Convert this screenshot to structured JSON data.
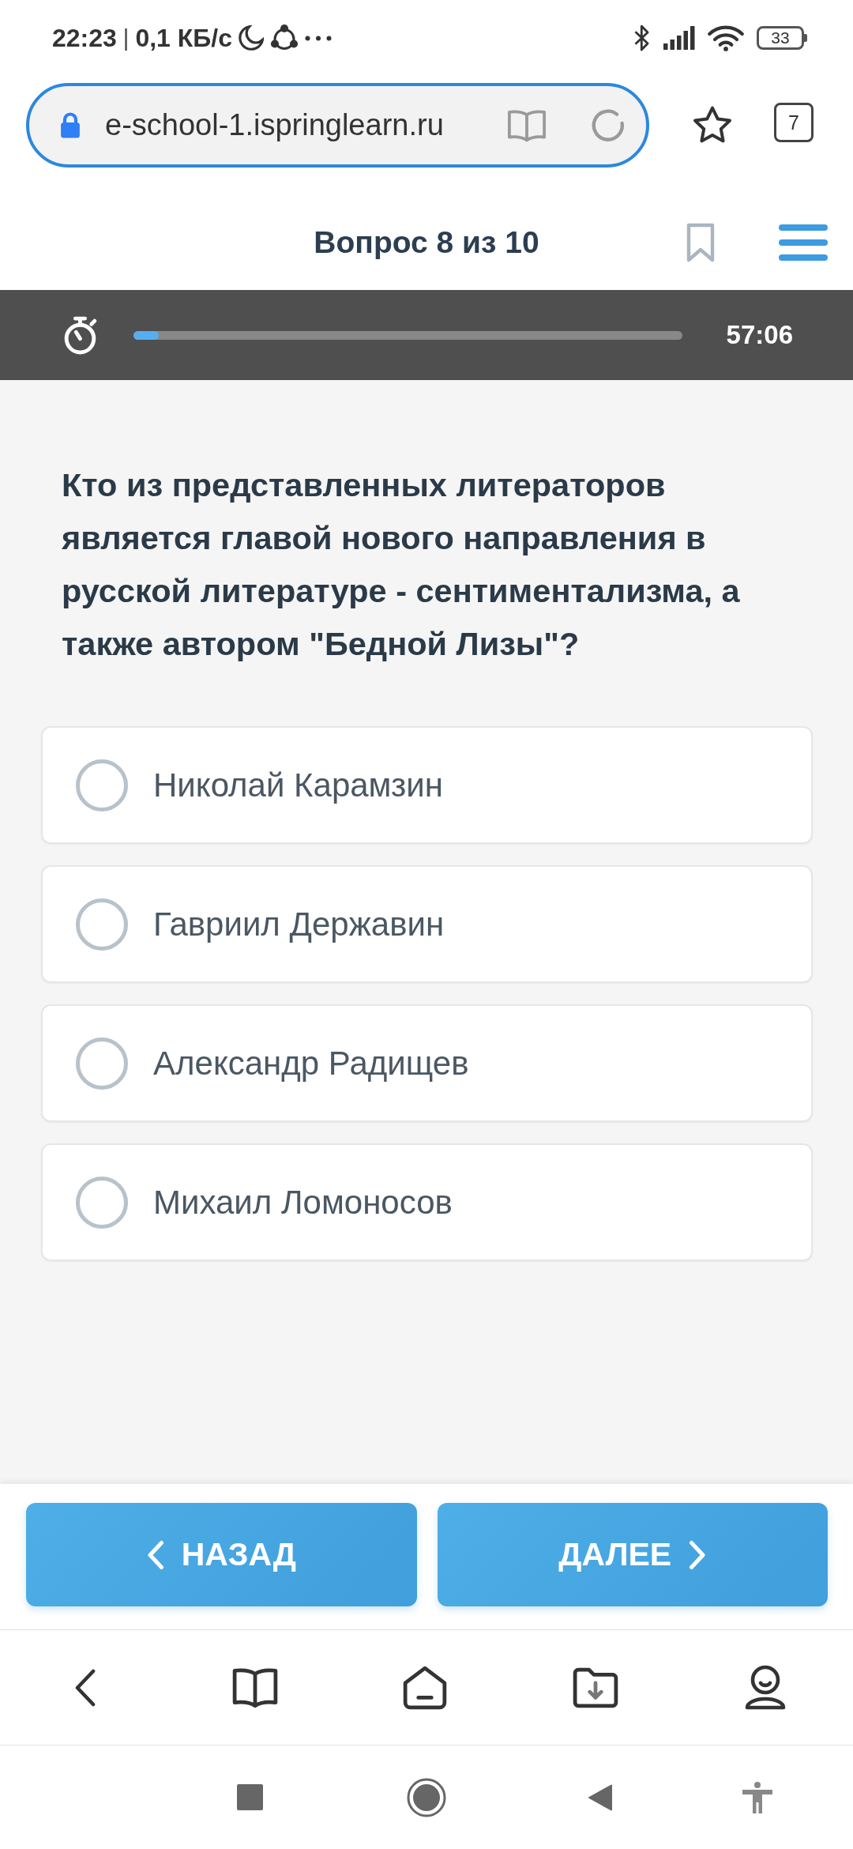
{
  "status_bar": {
    "time": "22:23",
    "separator": "|",
    "network_speed": "0,1 КБ/с",
    "battery": "33"
  },
  "browser": {
    "url": "e-school-1.ispringlearn.ru",
    "tab_count": "7"
  },
  "header": {
    "title": "Вопрос 8 из 10"
  },
  "timer": {
    "level": 0.046,
    "time": "57:06"
  },
  "question": {
    "text": "Кто из представленных литераторов является главой нового направления в русской литературе - сентиментализма, а также автором \"Бедной Лизы\"?"
  },
  "options": [
    {
      "label": "Николай Карамзин",
      "selected": false
    },
    {
      "label": "Гавриил Державин",
      "selected": false
    },
    {
      "label": "Александр Радищев",
      "selected": false
    },
    {
      "label": "Михаил Ломоносов",
      "selected": false
    }
  ],
  "buttons": [
    {
      "kind": "back",
      "label": "НАЗАД"
    },
    {
      "kind": "next",
      "label": "ДАЛЕЕ"
    }
  ]
}
